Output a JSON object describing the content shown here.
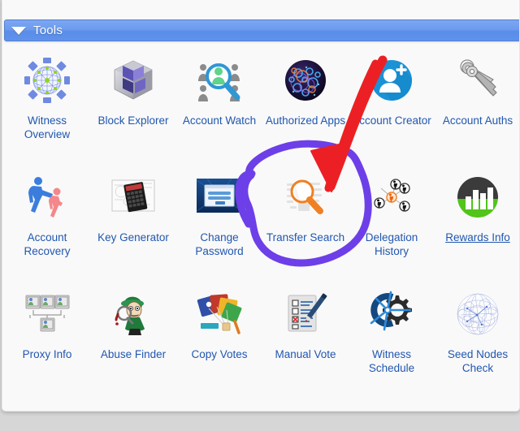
{
  "section": {
    "title": "Tools",
    "collapse_icon": "triangle-down-icon",
    "bar_color": "#6d9bee"
  },
  "link_color": "#2157b0",
  "tools": [
    {
      "label": "Witness Overview",
      "icon": "network-globe-icon",
      "hovered": false
    },
    {
      "label": "Block Explorer",
      "icon": "cube-icon",
      "hovered": false
    },
    {
      "label": "Account Watch",
      "icon": "people-magnifier-icon",
      "hovered": false
    },
    {
      "label": "Authorized Apps",
      "icon": "dark-sphere-apps-icon",
      "hovered": false
    },
    {
      "label": "Account Creator",
      "icon": "add-user-circle-icon",
      "hovered": false
    },
    {
      "label": "Account Auths",
      "icon": "keys-icon",
      "hovered": false
    },
    {
      "label": "Account Recovery",
      "icon": "helping-hands-icon",
      "hovered": false
    },
    {
      "label": "Key Generator",
      "icon": "calculator-icon",
      "hovered": false
    },
    {
      "label": "Change Password",
      "icon": "login-form-icon",
      "hovered": false
    },
    {
      "label": "Transfer Search",
      "icon": "document-magnifier-icon",
      "hovered": false
    },
    {
      "label": "Delegation History",
      "icon": "node-network-icon",
      "hovered": false
    },
    {
      "label": "Rewards Info",
      "icon": "bar-chart-circle-icon",
      "hovered": true
    },
    {
      "label": "Proxy Info",
      "icon": "computers-tree-icon",
      "hovered": false
    },
    {
      "label": "Abuse Finder",
      "icon": "detective-icon",
      "hovered": false
    },
    {
      "label": "Copy Votes",
      "icon": "colored-cards-icon",
      "hovered": false
    },
    {
      "label": "Manual Vote",
      "icon": "checklist-pen-icon",
      "hovered": false
    },
    {
      "label": "Witness Schedule",
      "icon": "gear-clock-icon",
      "hovered": false
    },
    {
      "label": "Seed Nodes Check",
      "icon": "wire-globe-icon",
      "hovered": false
    }
  ],
  "annotations": {
    "arrow": {
      "name": "red-arrow-annotation",
      "color": "#ec2024",
      "points_to": "Transfer Search"
    },
    "circle": {
      "name": "purple-circle-annotation",
      "color": "#6d3fe8",
      "encircles": "Transfer Search"
    }
  }
}
